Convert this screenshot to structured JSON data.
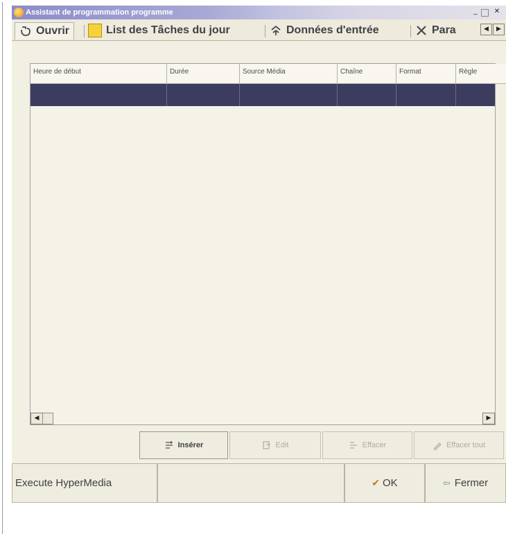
{
  "window": {
    "title": "Assistant de programmation programme"
  },
  "tabs": [
    {
      "label": "Ouvrir",
      "icon": "open-icon"
    },
    {
      "label": "List des Tâches du jour",
      "icon": "note-icon"
    },
    {
      "label": "Données d'entrée",
      "icon": "input-icon"
    },
    {
      "label": "Para",
      "icon": "tools-icon"
    }
  ],
  "table": {
    "columns": [
      "Heure de début",
      "Durée",
      "Source Média",
      "Chaîne",
      "Format",
      "Règle"
    ]
  },
  "actions": {
    "insert": "Insérer",
    "edit": "Edit",
    "erase": "Effacer",
    "erase_all": "Effacer tout"
  },
  "bottom": {
    "execute": "Execute HyperMedia",
    "ok": "OK",
    "close": "Fermer"
  },
  "colors": {
    "titlebar": "#8b8cc8",
    "selection": "#3c3c5e",
    "panel": "#f2efe3"
  }
}
